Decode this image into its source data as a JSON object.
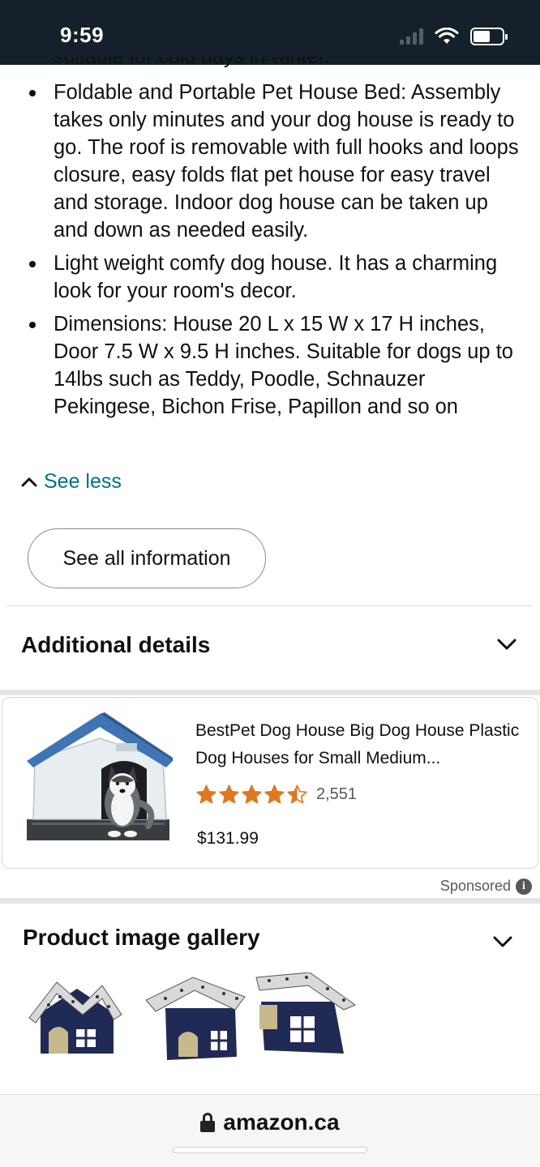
{
  "status_bar": {
    "time": "9:59"
  },
  "description": {
    "cutoff_text": "suitable for cold days in winter.",
    "bullets": [
      "Foldable and Portable Pet House Bed: Assembly takes only minutes and your dog house is ready to go. The roof is removable with full hooks and loops closure, easy folds flat pet house for easy travel and storage. Indoor dog house can be taken up and down as needed easily.",
      "Light weight comfy dog house. It has a charming look for your room's decor.",
      "Dimensions: House 20 L x 15 W x 17 H inches, Door 7.5 W x 9.5 H inches. Suitable for dogs up to 14lbs such as Teddy, Poodle, Schnauzer Pekingese, Bichon Frise, Papillon and so on"
    ],
    "see_less_label": "See less",
    "see_all_label": "See all information"
  },
  "additional_details": {
    "title": "Additional details"
  },
  "sponsored_ad": {
    "title": "BestPet Dog House Big Dog House Plastic Dog Houses for Small Medium...",
    "rating": 4.5,
    "rating_count": "2,551",
    "price": "$131.99",
    "sponsored_label": "Sponsored",
    "info_glyph": "i"
  },
  "gallery": {
    "title": "Product image gallery",
    "thumbnail_count": 3
  },
  "browser": {
    "url": "amazon.ca"
  },
  "colors": {
    "link": "#007185",
    "star": "#de7921",
    "text": "#0f1111",
    "status_bar_bg": "#15202b"
  }
}
